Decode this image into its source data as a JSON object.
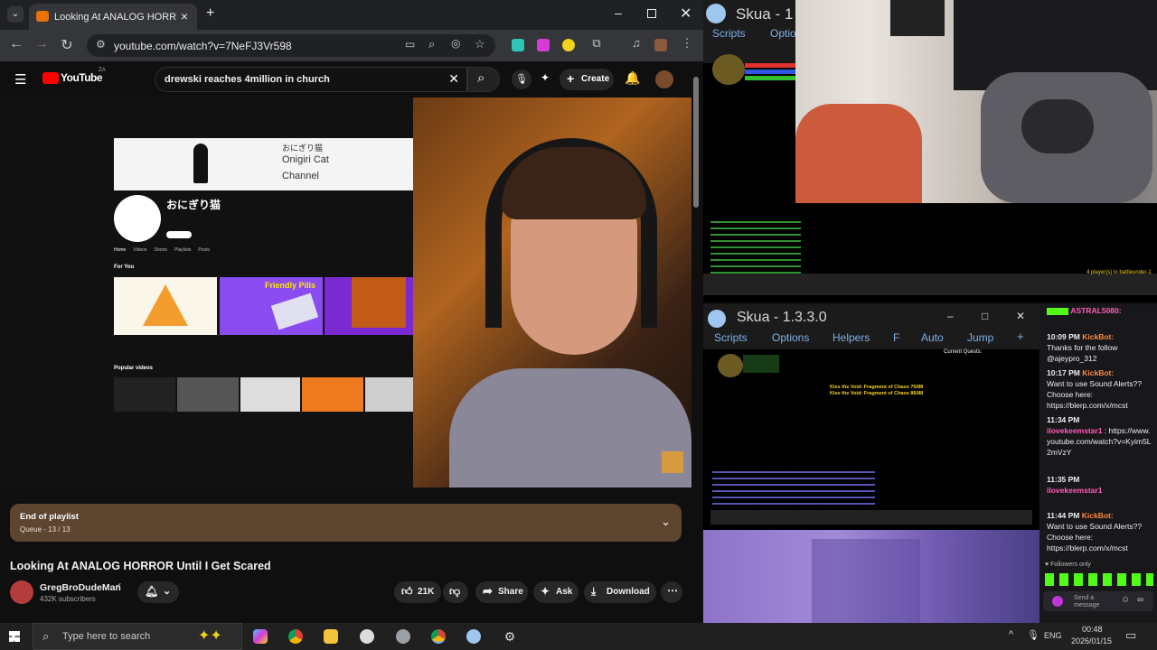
{
  "browser": {
    "tab_title": "Looking At ANALOG HORR",
    "url": "youtube.com/watch?v=7NeFJ3Vr598"
  },
  "youtube": {
    "logo": "YouTube",
    "logo_region": "ZA",
    "search_query": "drewski reaches 4million in church",
    "create_label": "Create"
  },
  "embedded_channel": {
    "banner_text_1": "Onigiri Cat",
    "banner_text_2": "Channel",
    "banner_jp": "おにぎり猫",
    "channel_name": "おにぎり猫",
    "tabs": [
      "Home",
      "Videos",
      "Shorts",
      "Playlists",
      "Posts"
    ],
    "section_for_you": "For You",
    "section_popular": "Popular videos",
    "thumb_friendly_pills": "Friendly Pills"
  },
  "playlist": {
    "title": "End of playlist",
    "queue": "Queue - 13 / 13"
  },
  "video": {
    "title": "Looking At ANALOG HORROR Until I Get Scared",
    "channel": "GregBroDudeMan",
    "subscribers": "432K subscribers",
    "likes": "21K",
    "share_label": "Share",
    "ask_label": "Ask",
    "download_label": "Download"
  },
  "skua_top": {
    "title": "Skua - 1",
    "menu": [
      "Scripts",
      "Optio"
    ]
  },
  "skua_bottom": {
    "title": "Skua - 1.3.3.0",
    "menu": [
      "Scripts",
      "Options",
      "Helpers",
      "F",
      "Auto",
      "Jump",
      "+"
    ],
    "players_text": "4 player(s) in battleunder-1",
    "current_quests": "Current Quests:",
    "msg_1": "Kiss the Void: Fragment of Chaos 75/88",
    "msg_2": "Kiss the Void: Fragment of Chaos 86/88"
  },
  "chat": {
    "messages": [
      {
        "time": "",
        "user": "ASTRAL5080:",
        "text": ""
      },
      {
        "time": "10:09 PM",
        "user": "KickBot:",
        "text": "Thanks for the follow @ajeypro_312"
      },
      {
        "time": "10:17 PM",
        "user": "KickBot:",
        "text": "Want to use Sound Alerts?? Choose here: https://blerp.com/x/mcst"
      },
      {
        "time": "11:34 PM",
        "user": "ilovekeemstar1",
        "text": ": https://www.youtube.com/watch?v=Kyim5L2mVzY"
      },
      {
        "time": "11:35 PM",
        "user": "ilovekeemstar1",
        "text": ""
      },
      {
        "time": "11:44 PM",
        "user": "KickBot:",
        "text": "Want to use Sound Alerts?? Choose here: https://blerp.com/x/mcst"
      }
    ],
    "followers_only": "Followers only",
    "send_placeholder": "Send a message"
  },
  "taskbar": {
    "search_placeholder": "Type here to search",
    "lang": "ENG",
    "time": "00:48",
    "date": "2026/01/15"
  },
  "colors": {
    "yt_red": "#ff0000",
    "kick_green": "#53fc18",
    "playlist_bg": "#5e4530"
  }
}
